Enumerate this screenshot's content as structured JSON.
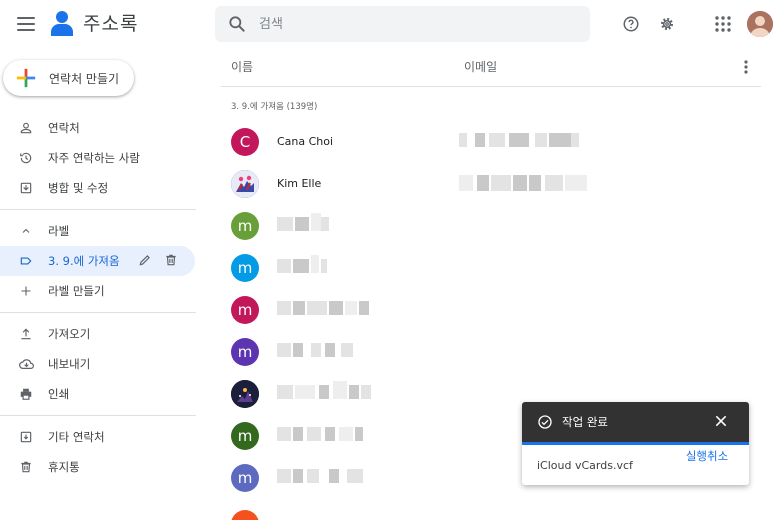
{
  "app": {
    "title": "주소록"
  },
  "search": {
    "placeholder": "검색"
  },
  "create_button": {
    "label": "연락처 만들기"
  },
  "sidebar": {
    "items": [
      {
        "label": "연락처",
        "icon": "person-icon"
      },
      {
        "label": "자주 연락하는 사람",
        "icon": "history-icon"
      },
      {
        "label": "병합 및 수정",
        "icon": "merge-icon"
      }
    ],
    "labels_header": "라벨",
    "active_label": "3. 9.에 가져옴",
    "create_label": "라벨 만들기",
    "tools": [
      {
        "label": "가져오기",
        "icon": "upload-icon"
      },
      {
        "label": "내보내기",
        "icon": "cloud-download-icon"
      },
      {
        "label": "인쇄",
        "icon": "print-icon"
      }
    ],
    "other": [
      {
        "label": "기타 연락처",
        "icon": "other-contacts-icon"
      },
      {
        "label": "휴지통",
        "icon": "trash-icon"
      }
    ]
  },
  "list": {
    "col_name": "이름",
    "col_email": "이메일",
    "group_label": "3. 9.에 가져옴 (139명)",
    "contacts": [
      {
        "initial": "C",
        "color": "#c2185b",
        "name": "Cana Choi"
      },
      {
        "initial": "",
        "color": "#1a237e",
        "name": "Kim Elle"
      },
      {
        "initial": "m",
        "color": "#689f38",
        "name": ""
      },
      {
        "initial": "m",
        "color": "#039be5",
        "name": ""
      },
      {
        "initial": "m",
        "color": "#c2185b",
        "name": ""
      },
      {
        "initial": "m",
        "color": "#5e35b1",
        "name": ""
      },
      {
        "initial": "",
        "color": "#1b1f3a",
        "name": ""
      },
      {
        "initial": "m",
        "color": "#33691e",
        "name": ""
      },
      {
        "initial": "m",
        "color": "#5c6bc0",
        "name": ""
      }
    ]
  },
  "snackbar": {
    "message": "작업 완료",
    "file": "iCloud vCards.vcf",
    "undo": "실행취소"
  },
  "colors": {
    "accent": "#1a73e8",
    "active_bg": "#e8f0fe"
  }
}
